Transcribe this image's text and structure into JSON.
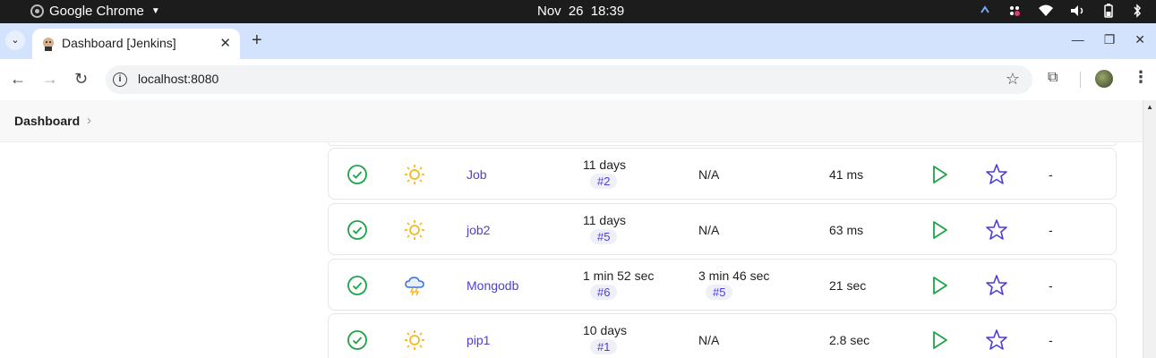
{
  "os": {
    "app_name": "Google Chrome",
    "clock": "Nov 26  18:39"
  },
  "browser": {
    "tab_title": "Dashboard [Jenkins]",
    "url": "localhost:8080"
  },
  "breadcrumb": {
    "items": [
      "Dashboard"
    ]
  },
  "jobs": [
    {
      "name": "Job",
      "status": "success",
      "weather": "sunny",
      "last_success": "11 days",
      "last_success_build": "#2",
      "last_failure": "N/A",
      "last_failure_build": "",
      "last_duration": "41 ms",
      "description": "-"
    },
    {
      "name": "job2",
      "status": "success",
      "weather": "sunny",
      "last_success": "11 days",
      "last_success_build": "#5",
      "last_failure": "N/A",
      "last_failure_build": "",
      "last_duration": "63 ms",
      "description": "-"
    },
    {
      "name": "Mongodb",
      "status": "success",
      "weather": "stormy",
      "last_success": "1 min 52 sec",
      "last_success_build": "#6",
      "last_failure": "3 min 46 sec",
      "last_failure_build": "#5",
      "last_duration": "21 sec",
      "description": "-"
    },
    {
      "name": "pip1",
      "status": "success",
      "weather": "sunny",
      "last_success": "10 days",
      "last_success_build": "#1",
      "last_failure": "N/A",
      "last_failure_build": "",
      "last_duration": "2.8 sec",
      "description": "-"
    }
  ],
  "colors": {
    "success": "#1ea446",
    "link": "#4d3fd6",
    "sun": "#f6b91c"
  }
}
